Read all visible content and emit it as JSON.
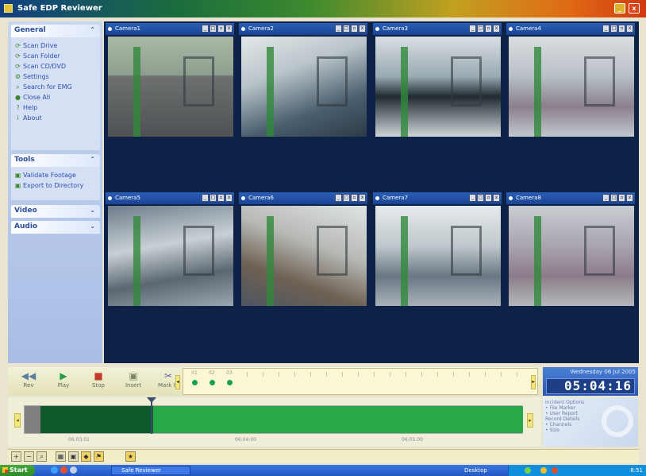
{
  "titlebar": {
    "title": "Safe EDP Reviewer",
    "minimize": "_",
    "close": "x"
  },
  "sidebar": {
    "general": {
      "title": "General",
      "items": [
        {
          "label": "Scan Drive",
          "icon": "scan-drive-icon",
          "glyph": "⟳"
        },
        {
          "label": "Scan Folder",
          "icon": "scan-folder-icon",
          "glyph": "⟳"
        },
        {
          "label": "Scan CD/DVD",
          "icon": "scan-cd-icon",
          "glyph": "⟳"
        },
        {
          "label": "Settings",
          "icon": "settings-icon",
          "glyph": "⚙"
        },
        {
          "label": "Search for EMG",
          "icon": "search-icon",
          "glyph": "⌕"
        },
        {
          "label": "Close All",
          "icon": "close-all-icon",
          "glyph": "●"
        },
        {
          "label": "Help",
          "icon": "help-icon",
          "glyph": "?"
        },
        {
          "label": "About",
          "icon": "about-icon",
          "glyph": "i"
        }
      ]
    },
    "tools": {
      "title": "Tools",
      "items": [
        {
          "label": "Validate Footage",
          "icon": "validate-icon",
          "glyph": "▣"
        },
        {
          "label": "Export to Directory",
          "icon": "export-icon",
          "glyph": "▣"
        }
      ]
    },
    "video": {
      "title": "Video"
    },
    "audio": {
      "title": "Audio"
    }
  },
  "cameras": [
    {
      "label": "Camera1"
    },
    {
      "label": "Camera2"
    },
    {
      "label": "Camera3"
    },
    {
      "label": "Camera4"
    },
    {
      "label": "Camera5"
    },
    {
      "label": "Camera6"
    },
    {
      "label": "Camera7"
    },
    {
      "label": "Camera8"
    }
  ],
  "controls": {
    "buttons": [
      {
        "label": "Rev",
        "glyph": "◀◀",
        "color": "#5a7fa0"
      },
      {
        "label": "Play",
        "glyph": "▶",
        "color": "#2a9a4a"
      },
      {
        "label": "Stop",
        "glyph": "■",
        "color": "#c43a2a"
      },
      {
        "label": "Insert",
        "glyph": "▣",
        "color": "#7a8a60"
      },
      {
        "label": "Mark In",
        "glyph": "✂",
        "color": "#6a5aa8"
      }
    ],
    "channels": [
      "01",
      "02",
      "03"
    ]
  },
  "clock": {
    "date": "Wednesday 06 Jul 2005",
    "time": "05:04:16"
  },
  "timeline": {
    "ticks": [
      "06:03:01",
      "06:04:00",
      "06:05:00"
    ]
  },
  "info": {
    "lines": [
      "Incident Options",
      "• File Marker",
      "• User Report",
      "Record Details",
      "• Channels",
      "• Size"
    ]
  },
  "taskbar": {
    "start": "Start",
    "app": "Safe Reviewer",
    "lang": "Desktop",
    "time": "8:51"
  },
  "colors": {
    "accent": "#2a5fb8",
    "video_bg": "#0e2248",
    "timeline_green": "#29a84a"
  }
}
